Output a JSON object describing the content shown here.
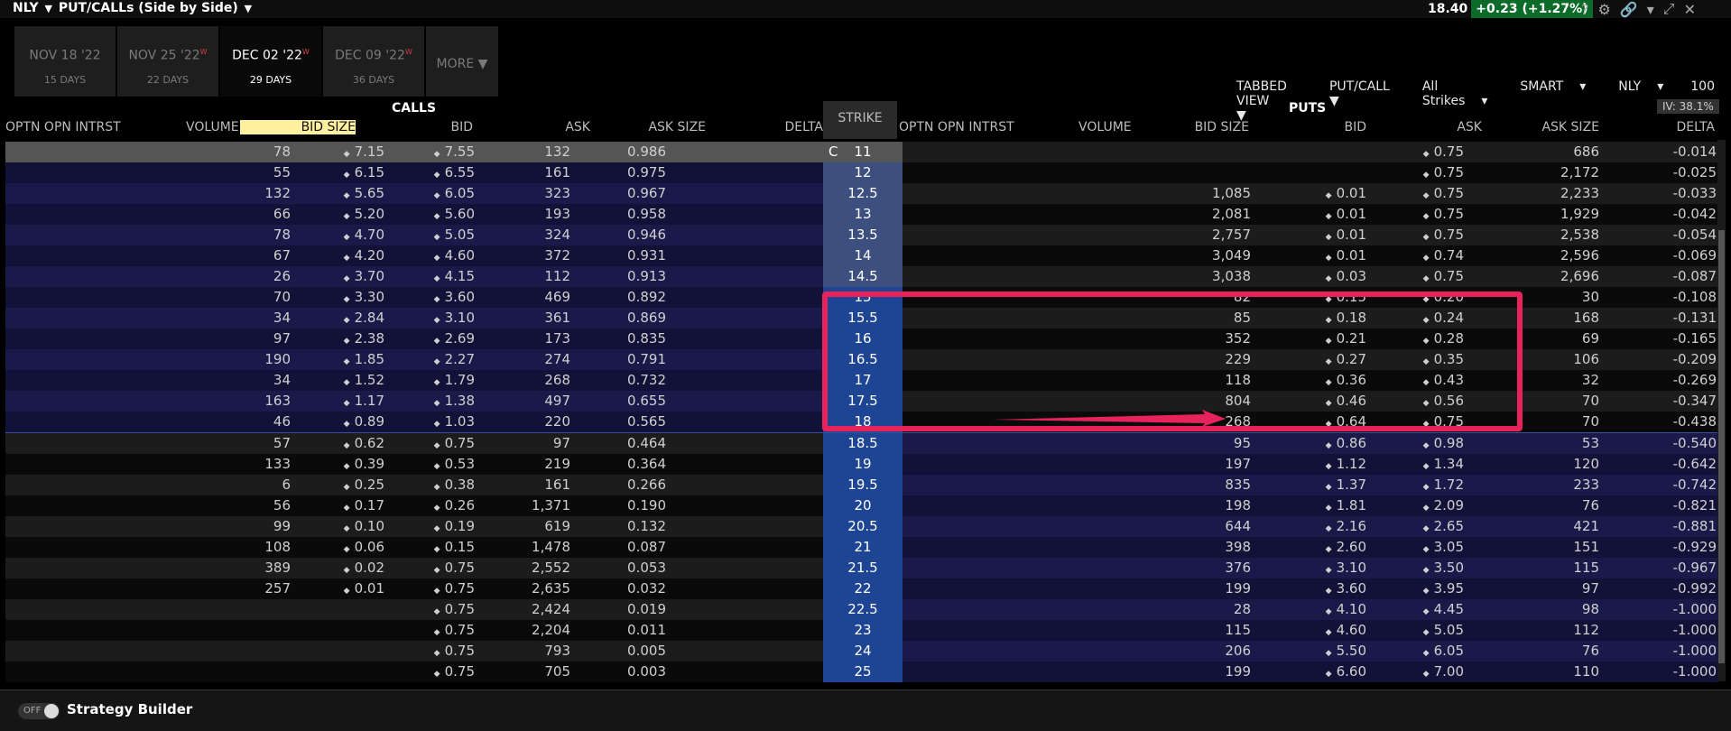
{
  "header": {
    "symbol": "NLY",
    "view_title": "PUT/CALLs (Side by Side)",
    "price": "18.40",
    "change": "+0.23 (+1.27%)"
  },
  "tabs": [
    {
      "label": "NOV 18 '22",
      "days": "15 DAYS",
      "active": false,
      "flag": ""
    },
    {
      "label": "NOV 25 '22",
      "days": "22 DAYS",
      "active": false,
      "flag": "W"
    },
    {
      "label": "DEC 02 '22",
      "days": "29 DAYS",
      "active": true,
      "flag": "W"
    },
    {
      "label": "DEC 09 '22",
      "days": "36 DAYS",
      "active": false,
      "flag": "W"
    }
  ],
  "more_label": "MORE",
  "toolbar": {
    "view": "TABBED VIEW",
    "putcall": "PUT/CALL",
    "strikes": "All Strikes",
    "exchange": "SMART",
    "symbol": "NLY",
    "multiplier": "100"
  },
  "iv": "IV: 38.1%",
  "calls_label": "CALLS",
  "puts_label": "PUTS",
  "strike_label": "STRIKE",
  "call_headers": {
    "oi": "OPTN OPN INTRST",
    "volume": "VOLUME",
    "bid_size": "BID SIZE",
    "bid": "BID",
    "ask": "ASK",
    "ask_size": "ASK SIZE",
    "delta": "DELTA"
  },
  "put_headers": {
    "oi": "OPTN OPN INTRST",
    "volume": "VOLUME",
    "bid_size": "BID SIZE",
    "bid": "BID",
    "ask": "ASK",
    "ask_size": "ASK SIZE",
    "delta": "DELTA"
  },
  "current_strike_marker": "C",
  "rows": [
    {
      "strike": "11",
      "c_bs": "78",
      "c_bid": "7.15",
      "c_ask": "7.55",
      "c_as": "132",
      "c_delta": "0.986",
      "p_bs": "",
      "p_bid": "",
      "p_ask": "0.75",
      "p_as": "686",
      "p_delta": "-0.014"
    },
    {
      "strike": "12",
      "c_bs": "55",
      "c_bid": "6.15",
      "c_ask": "6.55",
      "c_as": "161",
      "c_delta": "0.975",
      "p_bs": "",
      "p_bid": "",
      "p_ask": "0.75",
      "p_as": "2,172",
      "p_delta": "-0.025"
    },
    {
      "strike": "12.5",
      "c_bs": "132",
      "c_bid": "5.65",
      "c_ask": "6.05",
      "c_as": "323",
      "c_delta": "0.967",
      "p_bs": "1,085",
      "p_bid": "0.01",
      "p_ask": "0.75",
      "p_as": "2,233",
      "p_delta": "-0.033"
    },
    {
      "strike": "13",
      "c_bs": "66",
      "c_bid": "5.20",
      "c_ask": "5.60",
      "c_as": "193",
      "c_delta": "0.958",
      "p_bs": "2,081",
      "p_bid": "0.01",
      "p_ask": "0.75",
      "p_as": "1,929",
      "p_delta": "-0.042"
    },
    {
      "strike": "13.5",
      "c_bs": "78",
      "c_bid": "4.70",
      "c_ask": "5.05",
      "c_as": "324",
      "c_delta": "0.946",
      "p_bs": "2,757",
      "p_bid": "0.01",
      "p_ask": "0.75",
      "p_as": "2,538",
      "p_delta": "-0.054"
    },
    {
      "strike": "14",
      "c_bs": "67",
      "c_bid": "4.20",
      "c_ask": "4.60",
      "c_as": "372",
      "c_delta": "0.931",
      "p_bs": "3,049",
      "p_bid": "0.01",
      "p_ask": "0.74",
      "p_as": "2,596",
      "p_delta": "-0.069"
    },
    {
      "strike": "14.5",
      "c_bs": "26",
      "c_bid": "3.70",
      "c_ask": "4.15",
      "c_as": "112",
      "c_delta": "0.913",
      "p_bs": "3,038",
      "p_bid": "0.03",
      "p_ask": "0.75",
      "p_as": "2,696",
      "p_delta": "-0.087"
    },
    {
      "strike": "15",
      "c_bs": "70",
      "c_bid": "3.30",
      "c_ask": "3.60",
      "c_as": "469",
      "c_delta": "0.892",
      "p_bs": "82",
      "p_bid": "0.15",
      "p_ask": "0.20",
      "p_as": "30",
      "p_delta": "-0.108"
    },
    {
      "strike": "15.5",
      "c_bs": "34",
      "c_bid": "2.84",
      "c_ask": "3.10",
      "c_as": "361",
      "c_delta": "0.869",
      "p_bs": "85",
      "p_bid": "0.18",
      "p_ask": "0.24",
      "p_as": "168",
      "p_delta": "-0.131"
    },
    {
      "strike": "16",
      "c_bs": "97",
      "c_bid": "2.38",
      "c_ask": "2.69",
      "c_as": "173",
      "c_delta": "0.835",
      "p_bs": "352",
      "p_bid": "0.21",
      "p_ask": "0.28",
      "p_as": "69",
      "p_delta": "-0.165"
    },
    {
      "strike": "16.5",
      "c_bs": "190",
      "c_bid": "1.85",
      "c_ask": "2.27",
      "c_as": "274",
      "c_delta": "0.791",
      "p_bs": "229",
      "p_bid": "0.27",
      "p_ask": "0.35",
      "p_as": "106",
      "p_delta": "-0.209"
    },
    {
      "strike": "17",
      "c_bs": "34",
      "c_bid": "1.52",
      "c_ask": "1.79",
      "c_as": "268",
      "c_delta": "0.732",
      "p_bs": "118",
      "p_bid": "0.36",
      "p_ask": "0.43",
      "p_as": "32",
      "p_delta": "-0.269"
    },
    {
      "strike": "17.5",
      "c_bs": "163",
      "c_bid": "1.17",
      "c_ask": "1.38",
      "c_as": "497",
      "c_delta": "0.655",
      "p_bs": "804",
      "p_bid": "0.46",
      "p_ask": "0.56",
      "p_as": "70",
      "p_delta": "-0.347"
    },
    {
      "strike": "18",
      "c_bs": "46",
      "c_bid": "0.89",
      "c_ask": "1.03",
      "c_as": "220",
      "c_delta": "0.565",
      "p_bs": "268",
      "p_bid": "0.64",
      "p_ask": "0.75",
      "p_as": "70",
      "p_delta": "-0.438"
    },
    {
      "strike": "18.5",
      "c_bs": "57",
      "c_bid": "0.62",
      "c_ask": "0.75",
      "c_as": "97",
      "c_delta": "0.464",
      "p_bs": "95",
      "p_bid": "0.86",
      "p_ask": "0.98",
      "p_as": "53",
      "p_delta": "-0.540"
    },
    {
      "strike": "19",
      "c_bs": "133",
      "c_bid": "0.39",
      "c_ask": "0.53",
      "c_as": "219",
      "c_delta": "0.364",
      "p_bs": "197",
      "p_bid": "1.12",
      "p_ask": "1.34",
      "p_as": "120",
      "p_delta": "-0.642"
    },
    {
      "strike": "19.5",
      "c_bs": "6",
      "c_bid": "0.25",
      "c_ask": "0.38",
      "c_as": "161",
      "c_delta": "0.266",
      "p_bs": "835",
      "p_bid": "1.37",
      "p_ask": "1.72",
      "p_as": "233",
      "p_delta": "-0.742"
    },
    {
      "strike": "20",
      "c_bs": "56",
      "c_bid": "0.17",
      "c_ask": "0.26",
      "c_as": "1,371",
      "c_delta": "0.190",
      "p_bs": "198",
      "p_bid": "1.81",
      "p_ask": "2.09",
      "p_as": "76",
      "p_delta": "-0.821"
    },
    {
      "strike": "20.5",
      "c_bs": "99",
      "c_bid": "0.10",
      "c_ask": "0.19",
      "c_as": "619",
      "c_delta": "0.132",
      "p_bs": "644",
      "p_bid": "2.16",
      "p_ask": "2.65",
      "p_as": "421",
      "p_delta": "-0.881"
    },
    {
      "strike": "21",
      "c_bs": "108",
      "c_bid": "0.06",
      "c_ask": "0.15",
      "c_as": "1,478",
      "c_delta": "0.087",
      "p_bs": "398",
      "p_bid": "2.60",
      "p_ask": "3.05",
      "p_as": "151",
      "p_delta": "-0.929"
    },
    {
      "strike": "21.5",
      "c_bs": "389",
      "c_bid": "0.02",
      "c_ask": "0.75",
      "c_as": "2,552",
      "c_delta": "0.053",
      "p_bs": "376",
      "p_bid": "3.10",
      "p_ask": "3.50",
      "p_as": "115",
      "p_delta": "-0.967"
    },
    {
      "strike": "22",
      "c_bs": "257",
      "c_bid": "0.01",
      "c_ask": "0.75",
      "c_as": "2,635",
      "c_delta": "0.032",
      "p_bs": "199",
      "p_bid": "3.60",
      "p_ask": "3.95",
      "p_as": "97",
      "p_delta": "-0.992"
    },
    {
      "strike": "22.5",
      "c_bs": "",
      "c_bid": "",
      "c_ask": "0.75",
      "c_as": "2,424",
      "c_delta": "0.019",
      "p_bs": "28",
      "p_bid": "4.10",
      "p_ask": "4.45",
      "p_as": "98",
      "p_delta": "-1.000"
    },
    {
      "strike": "23",
      "c_bs": "",
      "c_bid": "",
      "c_ask": "0.75",
      "c_as": "2,204",
      "c_delta": "0.011",
      "p_bs": "115",
      "p_bid": "4.60",
      "p_ask": "5.05",
      "p_as": "112",
      "p_delta": "-1.000"
    },
    {
      "strike": "24",
      "c_bs": "",
      "c_bid": "",
      "c_ask": "0.75",
      "c_as": "793",
      "c_delta": "0.005",
      "p_bs": "206",
      "p_bid": "5.50",
      "p_ask": "6.05",
      "p_as": "76",
      "p_delta": "-1.000"
    },
    {
      "strike": "25",
      "c_bs": "",
      "c_bid": "",
      "c_ask": "0.75",
      "c_as": "705",
      "c_delta": "0.003",
      "p_bs": "199",
      "p_bid": "6.60",
      "p_ask": "7.00",
      "p_as": "110",
      "p_delta": "-1.000"
    }
  ],
  "footer": {
    "toggle_label": "OFF",
    "strategy_builder": "Strategy Builder"
  },
  "colors": {
    "strike_bg": "#1e4594",
    "itm_row": "#1a1a4a",
    "highlight": "#e8225a",
    "bidsize_header": "#fff0a0"
  }
}
